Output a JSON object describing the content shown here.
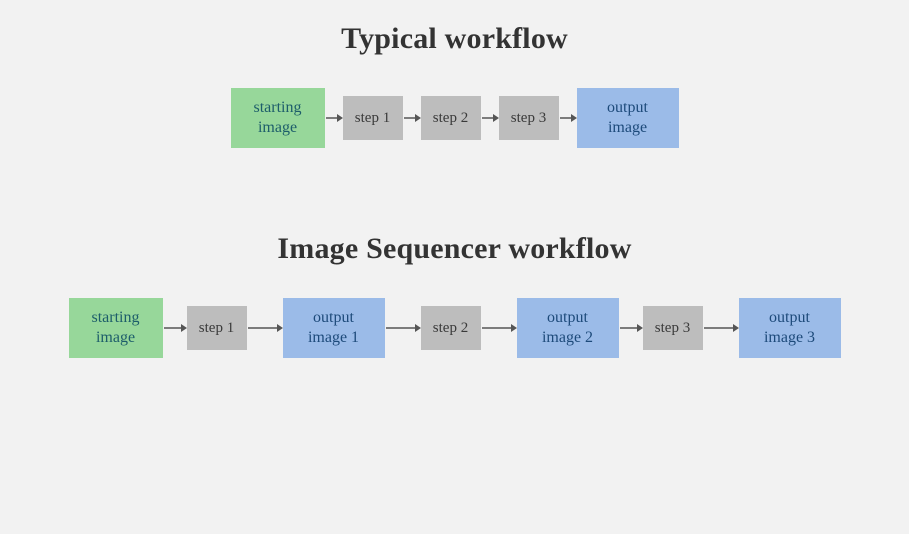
{
  "section1": {
    "title": "Typical workflow",
    "start": "starting image",
    "step1": "step 1",
    "step2": "step 2",
    "step3": "step 3",
    "output": "output image"
  },
  "section2": {
    "title": "Image Sequencer workflow",
    "start": "starting image",
    "step1": "step 1",
    "out1": "output image 1",
    "step2": "step 2",
    "out2": "output image 2",
    "step3": "step 3",
    "out3": "output image 3"
  },
  "colors": {
    "start_bg": "#97d79a",
    "step_bg": "#bdbdbd",
    "output_bg": "#9bbbe8",
    "page_bg": "#f2f2f2"
  }
}
